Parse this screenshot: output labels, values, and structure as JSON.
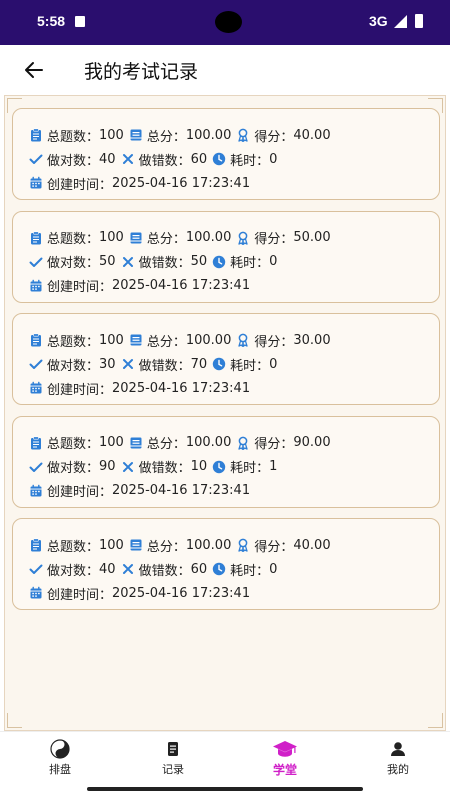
{
  "status_bar": {
    "time": "5:58",
    "network": "3G"
  },
  "header": {
    "title": "我的考试记录"
  },
  "labels": {
    "total_questions": "总题数：",
    "total_score": "总分：",
    "score": "得分：",
    "correct": "做对数：",
    "wrong": "做错数：",
    "time_used": "耗时：",
    "created": "创建时间："
  },
  "records": [
    {
      "total": "100",
      "total_score": "100.00",
      "score": "40.00",
      "correct": "40",
      "wrong": "60",
      "time": "0",
      "created": "2025-04-16 17:23:41"
    },
    {
      "total": "100",
      "total_score": "100.00",
      "score": "50.00",
      "correct": "50",
      "wrong": "50",
      "time": "0",
      "created": "2025-04-16 17:23:41"
    },
    {
      "total": "100",
      "total_score": "100.00",
      "score": "30.00",
      "correct": "30",
      "wrong": "70",
      "time": "0",
      "created": "2025-04-16 17:23:41"
    },
    {
      "total": "100",
      "total_score": "100.00",
      "score": "90.00",
      "correct": "90",
      "wrong": "10",
      "time": "1",
      "created": "2025-04-16 17:23:41"
    },
    {
      "total": "100",
      "total_score": "100.00",
      "score": "40.00",
      "correct": "40",
      "wrong": "60",
      "time": "0",
      "created": "2025-04-16 17:23:41"
    }
  ],
  "nav": {
    "tabs": [
      {
        "label": "排盘",
        "icon": "yin-yang-icon"
      },
      {
        "label": "记录",
        "icon": "document-icon"
      },
      {
        "label": "学堂",
        "icon": "graduation-cap-icon"
      },
      {
        "label": "我的",
        "icon": "person-icon"
      }
    ],
    "active_index": 2
  },
  "colors": {
    "accent_blue": "#2f7fd6",
    "active_tab": "#d020c8",
    "status_bar": "#2a0e6e",
    "card_border": "#d9c09c"
  }
}
